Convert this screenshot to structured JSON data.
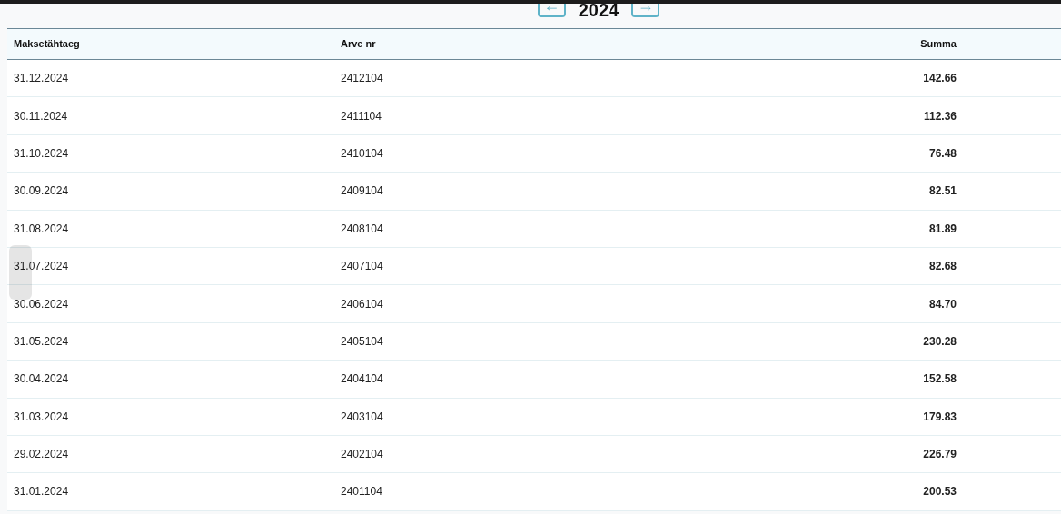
{
  "year_nav": {
    "prev": "←",
    "year": "2024",
    "next": "→"
  },
  "table": {
    "columns": [
      "Maksetähtaeg",
      "Arve nr",
      "Summa"
    ],
    "rows": [
      [
        "31.12.2024",
        "2412104",
        "142.66"
      ],
      [
        "30.11.2024",
        "2411104",
        "112.36"
      ],
      [
        "31.10.2024",
        "2410104",
        "76.48"
      ],
      [
        "30.09.2024",
        "2409104",
        "82.51"
      ],
      [
        "31.08.2024",
        "2408104",
        "81.89"
      ],
      [
        "31.07.2024",
        "2407104",
        "82.68"
      ],
      [
        "30.06.2024",
        "2406104",
        "84.70"
      ],
      [
        "31.05.2024",
        "2405104",
        "230.28"
      ],
      [
        "30.04.2024",
        "2404104",
        "152.58"
      ],
      [
        "31.03.2024",
        "2403104",
        "179.83"
      ],
      [
        "29.02.2024",
        "2402104",
        "226.79"
      ],
      [
        "31.01.2024",
        "2401104",
        "200.53"
      ]
    ]
  }
}
